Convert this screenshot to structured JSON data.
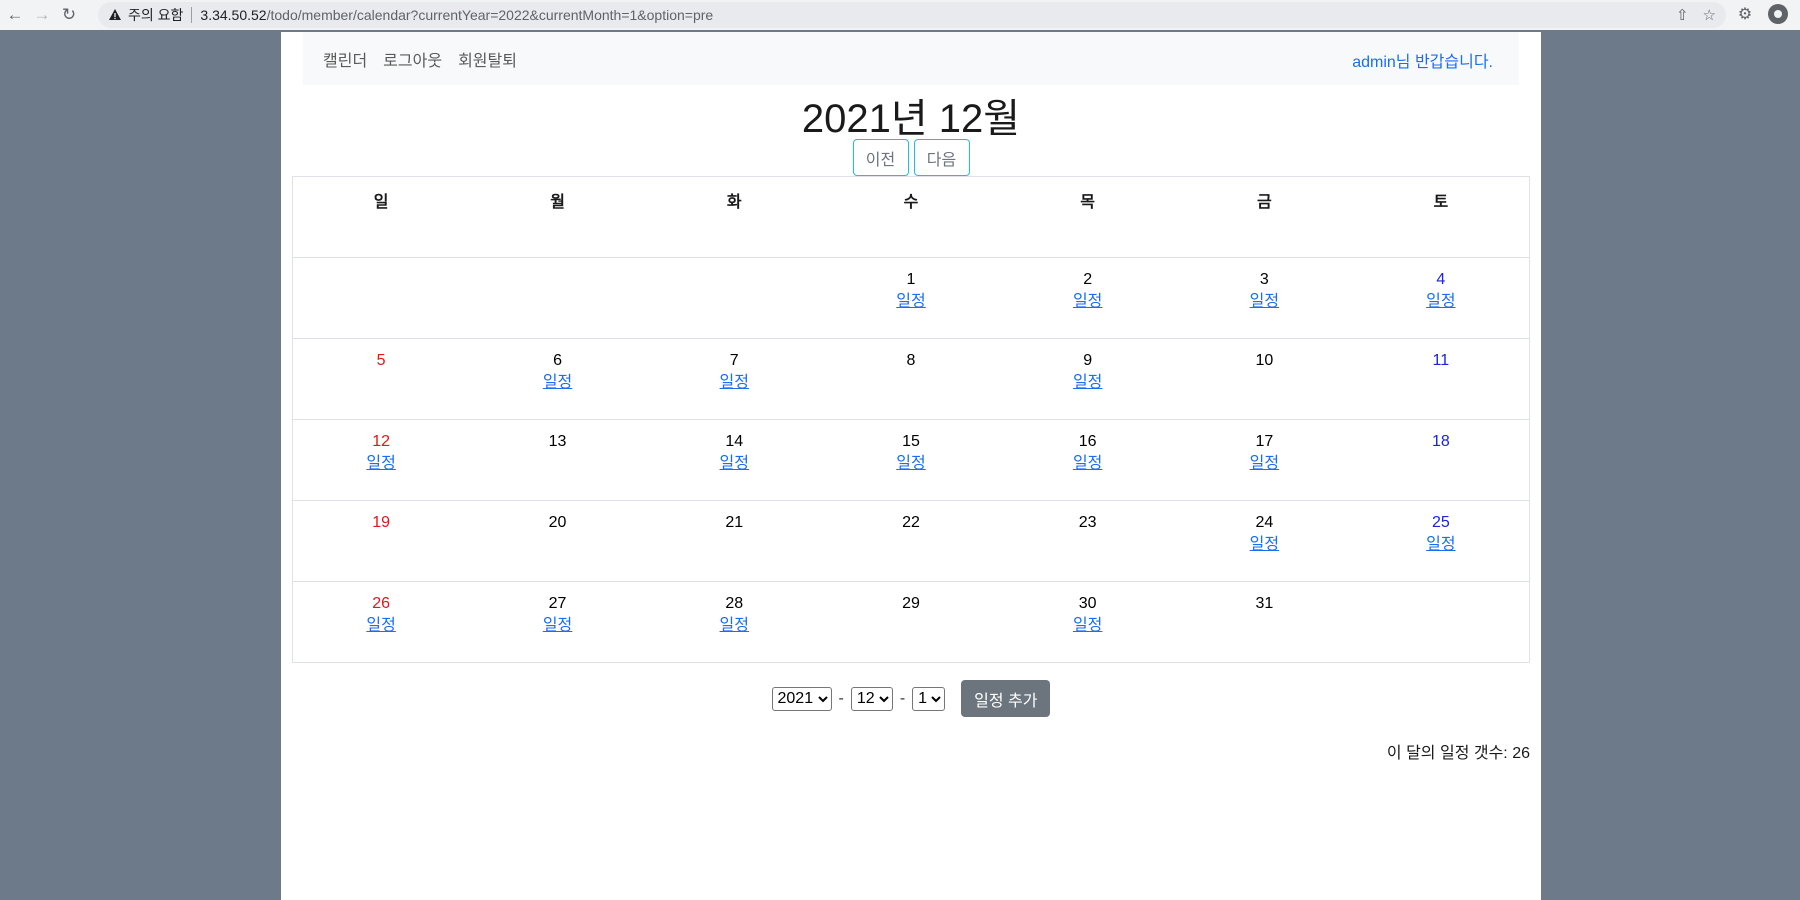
{
  "browser": {
    "warning_label": "주의 요함",
    "url_host": "3.34.50.52",
    "url_path": "/todo/member/calendar?currentYear=2022&currentMonth=1&option=pre"
  },
  "navbar": {
    "links": [
      "캘린더",
      "로그아웃",
      "회원탈퇴"
    ],
    "greeting": "admin님 반갑습니다."
  },
  "calendar": {
    "title": "2021년 12월",
    "prev_label": "이전",
    "next_label": "다음",
    "weekdays": [
      "일",
      "월",
      "화",
      "수",
      "목",
      "금",
      "토"
    ],
    "todo_label": "일정",
    "weeks": [
      [
        {
          "day": ""
        },
        {
          "day": ""
        },
        {
          "day": ""
        },
        {
          "day": "1",
          "todo": true
        },
        {
          "day": "2",
          "todo": true
        },
        {
          "day": "3",
          "todo": true
        },
        {
          "day": "4",
          "todo": true
        }
      ],
      [
        {
          "day": "5"
        },
        {
          "day": "6",
          "todo": true
        },
        {
          "day": "7",
          "todo": true
        },
        {
          "day": "8"
        },
        {
          "day": "9",
          "todo": true
        },
        {
          "day": "10"
        },
        {
          "day": "11"
        }
      ],
      [
        {
          "day": "12",
          "todo": true
        },
        {
          "day": "13"
        },
        {
          "day": "14",
          "todo": true
        },
        {
          "day": "15",
          "todo": true
        },
        {
          "day": "16",
          "todo": true
        },
        {
          "day": "17",
          "todo": true
        },
        {
          "day": "18"
        }
      ],
      [
        {
          "day": "19"
        },
        {
          "day": "20"
        },
        {
          "day": "21"
        },
        {
          "day": "22"
        },
        {
          "day": "23"
        },
        {
          "day": "24",
          "todo": true
        },
        {
          "day": "25",
          "todo": true
        }
      ],
      [
        {
          "day": "26",
          "todo": true
        },
        {
          "day": "27",
          "todo": true
        },
        {
          "day": "28",
          "todo": true
        },
        {
          "day": "29"
        },
        {
          "day": "30",
          "todo": true
        },
        {
          "day": "31"
        },
        {
          "day": ""
        }
      ]
    ]
  },
  "add_form": {
    "year": "2021",
    "month": "12",
    "day": "1",
    "separator": "-",
    "button_label": "일정 추가"
  },
  "summary": {
    "label": "이 달의 일정 갯수: 26"
  },
  "colors": {
    "sunday": "#e8141c",
    "saturday": "#1a23e0",
    "link": "#1a6ef5",
    "background": "#6c7a8a"
  }
}
